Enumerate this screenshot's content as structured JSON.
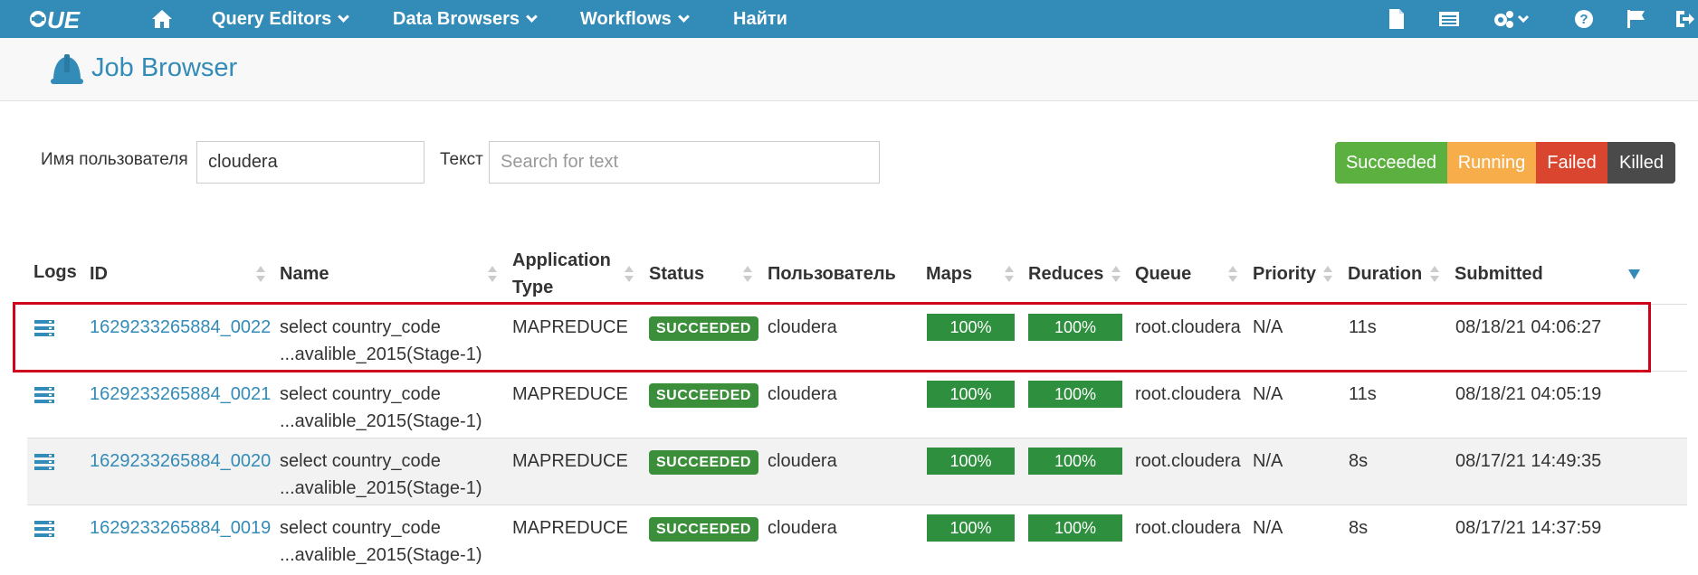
{
  "nav": {
    "logo_text": "HUE",
    "home_icon": "home-icon",
    "items": [
      {
        "label": "Query Editors",
        "caret": true
      },
      {
        "label": "Data Browsers",
        "caret": true
      },
      {
        "label": "Workflows",
        "caret": true
      },
      {
        "label": "Найти",
        "caret": false
      }
    ],
    "right_icons": [
      "file-icon",
      "list-icon",
      "cogs-icon",
      "help-icon",
      "flag-icon",
      "logout-icon"
    ]
  },
  "page": {
    "title": "Job Browser",
    "icon": "hard-hat-icon"
  },
  "filters": {
    "user_label": "Имя пользователя",
    "user_value": "cloudera",
    "text_label": "Текст",
    "text_placeholder": "Search for text"
  },
  "status_buttons": [
    {
      "label": "Succeeded",
      "color": "#5cb040"
    },
    {
      "label": "Running",
      "color": "#f8ad4b"
    },
    {
      "label": "Failed",
      "color": "#d9452e"
    },
    {
      "label": "Killed",
      "color": "#4a4a4a"
    }
  ],
  "table": {
    "headers": {
      "logs": "Logs",
      "id": "ID",
      "name": "Name",
      "app_type_1": "Application",
      "app_type_2": "Type",
      "status": "Status",
      "user": "Пользователь",
      "maps": "Maps",
      "reduces": "Reduces",
      "queue": "Queue",
      "priority": "Priority",
      "duration": "Duration",
      "submitted": "Submitted"
    },
    "rows": [
      {
        "id": "1629233265884_0022",
        "name1": "select country_code",
        "name2": "...avalible_2015(Stage-1)",
        "type": "MAPREDUCE",
        "status": "SUCCEEDED",
        "user": "cloudera",
        "maps": "100%",
        "reduces": "100%",
        "queue": "root.cloudera",
        "priority": "N/A",
        "duration": "11s",
        "submitted": "08/18/21 04:06:27"
      },
      {
        "id": "1629233265884_0021",
        "name1": "select country_code",
        "name2": "...avalible_2015(Stage-1)",
        "type": "MAPREDUCE",
        "status": "SUCCEEDED",
        "user": "cloudera",
        "maps": "100%",
        "reduces": "100%",
        "queue": "root.cloudera",
        "priority": "N/A",
        "duration": "11s",
        "submitted": "08/18/21 04:05:19"
      },
      {
        "id": "1629233265884_0020",
        "name1": "select country_code",
        "name2": "...avalible_2015(Stage-1)",
        "type": "MAPREDUCE",
        "status": "SUCCEEDED",
        "user": "cloudera",
        "maps": "100%",
        "reduces": "100%",
        "queue": "root.cloudera",
        "priority": "N/A",
        "duration": "8s",
        "submitted": "08/17/21 14:49:35"
      },
      {
        "id": "1629233265884_0019",
        "name1": "select country_code",
        "name2": "...avalible_2015(Stage-1)",
        "type": "MAPREDUCE",
        "status": "SUCCEEDED",
        "user": "cloudera",
        "maps": "100%",
        "reduces": "100%",
        "queue": "root.cloudera",
        "priority": "N/A",
        "duration": "8s",
        "submitted": "08/17/21 14:37:59"
      }
    ]
  },
  "colors": {
    "navbar": "#338bb8",
    "link": "#338bb8",
    "progress": "#2e8f3e",
    "badge": "#3b8f3b",
    "highlight": "#d0021b"
  }
}
